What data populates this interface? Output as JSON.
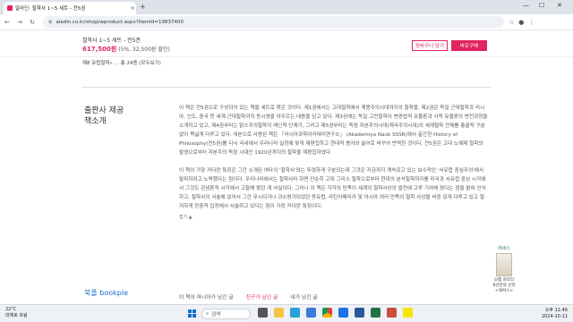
{
  "browser": {
    "tab_title": "알라딘: 철학사 1~5 세트 - 전5권",
    "tab_close": "×",
    "new_tab": "+",
    "url": "aladin.co.kr/shop/wproduct.aspx?ItemId=19837400",
    "win_min": "—",
    "win_max": "☐",
    "win_close": "✕"
  },
  "product": {
    "title": "철학사 1~5 세트 - 전5권",
    "price": "617,500원",
    "price_detail": " (5%, 32,500원 할인)",
    "cart_button": "장바구니 담기",
    "buy_button": "바로구매",
    "toc_tail": "제8 유럽철학»  ... 총 24종 (모두보기)"
  },
  "section": {
    "title": "출판사 제공\n책소개",
    "para1": "이 책은 전5권으로 구성되어 있는 책을 세트로 묶은 것이다. 제1권에서는 고대철학에서 계몽주의시대까지의 철학을, 제2권은 독일 근대철학과 러시아, 인도, 중국 등 세계 근대철학까지 동시영을 아우르는 내용을 담고 있다. 제3권에는 독일 고전철학이 변증법적 유물론과 사적 유물론의 변천과정을 소개하고 있고, 제4권부터는 맑스주의철학의 레닌적 단계가, 그리고 제5권부터는 독점 자본주의시대(제국주의시대)의 세계철학 전체를 총괄적 구분없이 목넓게 다루고 있다. 대본으로 사용된 책은 「러시아과학아카데미연구소」 (Akademiya Nauk SSSR)에서 출간한 History of Philosophy(전5권)를 다시 국내에서 우리나라 실정에 맞게 재편집하고 현대적 용어와 술어로 바꾸어 번역한 것이다. 전5권은 고대 노예제 철학의 발생으로부터 자본주의 독점 시대인 1920년까지의 철학을 재편집하였다.",
    "para2": "이 책의 가장 커다란 특징은 그간 소개된 여타의 '철학사'와는 뚜렷하게 구분되는데 그것은 지금까지 계속되고 있는 보수적인 '서유럽 중심주의'에서 탈피하려고 노력했다는 점이다. 우리나라에서는 철학사라 하면 단순히 고대 그리스 철학으로부터 현대의 분석철학까지를 미국과 서유럽 중심 시각에서 그것도 관념론적 시각에서 고찰해 왔던 게 사실이다. 그러나 이 책은 각각의 민족이 세계의 철학사상의 발전에 고루 기여해 왔다는 점을 밝혀 인식하고, 철학사의 서술에 있어서 그간 무시되거나 과소평가되었던 동유럽, 라틴아메리카 및 아시아 여러 민족의 철학 사상을 비중 있게 다루고 있고 철저하게 민중적 입장에서 서술하고 있다는 점이 가장 커다란 특징이다.",
    "more": "접기 ▲"
  },
  "bookple": {
    "title": "북플 bookple",
    "tabs": [
      "이 책의 마니아가 남긴 글",
      "친구가 남긴 글",
      "내가 남긴 글"
    ]
  },
  "sidead": {
    "top": "에세스",
    "line1": "모렘 하라리",
    "line2": "6년만의 신작",
    "line3": "<넥서스>"
  },
  "taskbar": {
    "temp": "22°C",
    "weather": "대체로 흐림",
    "search": "검색",
    "time": "오후 11:46",
    "date": "2024-10-11"
  }
}
